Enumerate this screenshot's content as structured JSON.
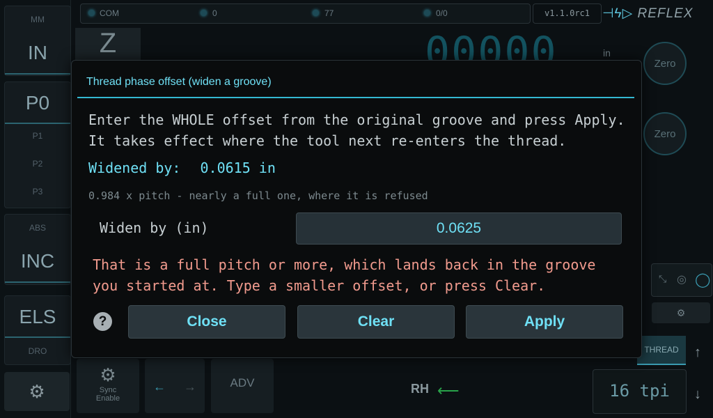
{
  "sidebar": {
    "mm": "MM",
    "in": "IN",
    "po": "P0",
    "p1": "P1",
    "p2": "P2",
    "p3": "P3",
    "abs": "ABS",
    "inc": "INC",
    "els": "ELS",
    "dro": "DRO"
  },
  "status": {
    "com": "COM",
    "v1": "0",
    "v2": "77",
    "v3": "0/0",
    "version": "v1.1.0rc1"
  },
  "brand": {
    "name": "REFLEX"
  },
  "axis": {
    "z": "Z",
    "digits": "00000",
    "unit": "in"
  },
  "zero": [
    "Zero",
    "Zero"
  ],
  "bottom": {
    "sync": "Sync",
    "enable": "Enable",
    "adv": "ADV",
    "rh": "RH",
    "thread": "THREAD",
    "tpi": "16 tpi",
    "left_arrow": "←",
    "right_arrow": "→"
  },
  "dialog": {
    "title": "Thread phase offset (widen a groove)",
    "message_line1": "Enter the WHOLE offset from the original groove and press Apply.",
    "message_line2": "It takes effect where the tool next re-enters the thread.",
    "widened_label": "Widened by:",
    "widened_value": "0.0615 in",
    "note": "0.984 x pitch - nearly a full one, where it is refused",
    "widen_label": "Widen by (in)",
    "widen_value": "0.0625",
    "error_line1": "That is a full pitch or more, which lands back in the groove",
    "error_line2": "you started at. Type a smaller offset, or press Clear.",
    "help": "?",
    "close": "Close",
    "clear": "Clear",
    "apply": "Apply"
  }
}
